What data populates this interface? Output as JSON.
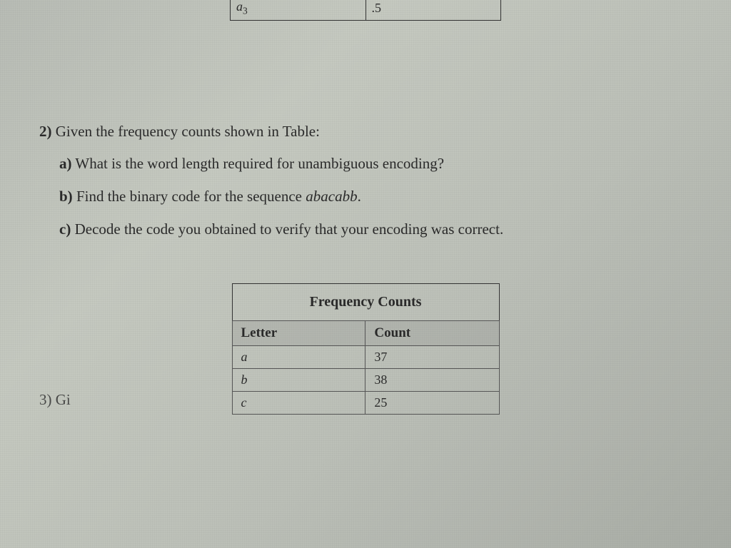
{
  "top_table": {
    "row": {
      "label": "a",
      "sub": "3",
      "value": ".5"
    }
  },
  "question": {
    "number": "2)",
    "stem": "Given the frequency counts shown in Table:",
    "parts": {
      "a": {
        "label": "a)",
        "text": "What is the word length required for unambiguous encoding?"
      },
      "b": {
        "label": "b)",
        "text_before": "Find the binary code for the sequence ",
        "seq": "abacabb",
        "text_after": "."
      },
      "c": {
        "label": "c)",
        "text": "Decode the code you obtained to verify that your encoding was correct."
      }
    }
  },
  "freq_table": {
    "title": "Frequency  Counts",
    "col1": "Letter",
    "col2": "Count",
    "rows": [
      {
        "letter": "a",
        "count": "37"
      },
      {
        "letter": "b",
        "count": "38"
      },
      {
        "letter": "c",
        "count": "25"
      }
    ]
  },
  "chart_data": {
    "type": "table",
    "title": "Frequency Counts",
    "columns": [
      "Letter",
      "Count"
    ],
    "rows": [
      [
        "a",
        37
      ],
      [
        "b",
        38
      ],
      [
        "c",
        25
      ]
    ]
  },
  "bottom_fragment": "3) Gi"
}
